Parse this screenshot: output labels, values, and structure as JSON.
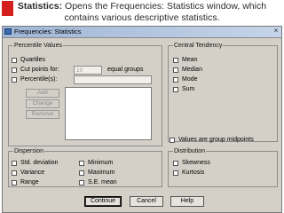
{
  "caption": {
    "bold": "Statistics:",
    "text": " Opens the Frequencies: Statistics window, which contains various descriptive statistics."
  },
  "dialog": {
    "title": "Frequencies: Statistics",
    "close_label": "×",
    "percentile": {
      "legend": "Percentile Values",
      "quartiles": "Quartiles",
      "cut_points": "Cut points for:",
      "cut_value": "10",
      "equal_groups": "equal groups",
      "percentiles": "Percentile(s):",
      "add": "Add",
      "change": "Change",
      "remove": "Remove"
    },
    "central": {
      "legend": "Central Tendency",
      "mean": "Mean",
      "median": "Median",
      "mode": "Mode",
      "sum": "Sum"
    },
    "midpoints": "Values are group midpoints",
    "dispersion": {
      "legend": "Dispersion",
      "std": "Std. deviation",
      "variance": "Variance",
      "range": "Range",
      "minimum": "Minimum",
      "maximum": "Maximum",
      "se_mean": "S.E. mean"
    },
    "distribution": {
      "legend": "Distribution",
      "skewness": "Skewness",
      "kurtosis": "Kurtosis"
    },
    "buttons": {
      "continue": "Continue",
      "cancel": "Cancel",
      "help": "Help"
    }
  }
}
